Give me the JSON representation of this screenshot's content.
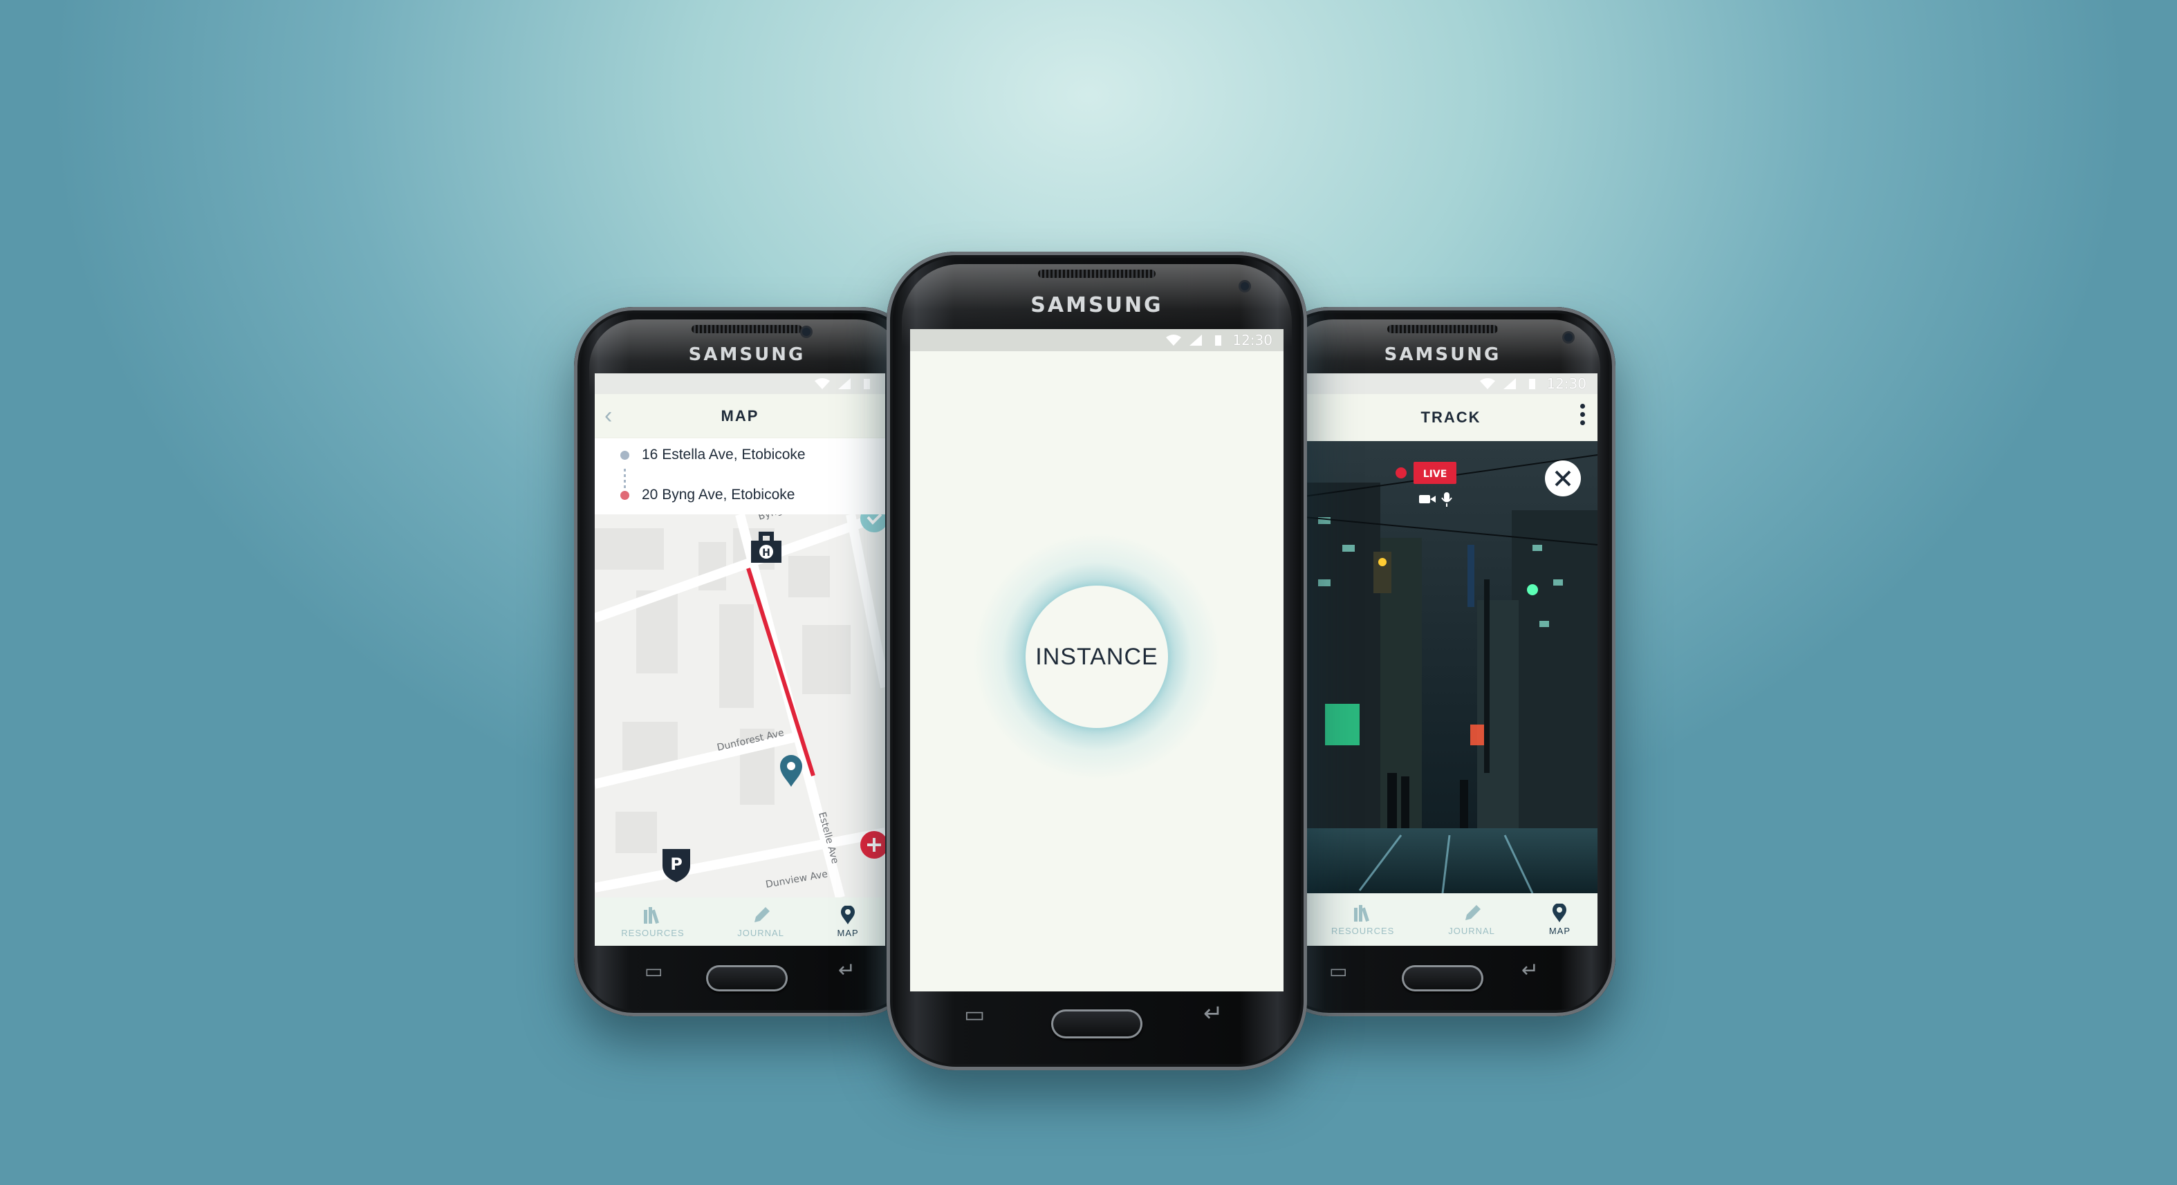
{
  "brand": "SAMSUNG",
  "status_time": "12:30",
  "map_screen": {
    "title": "MAP",
    "origin": "16 Estella Ave, Etobicoke",
    "destination": "20 Byng Ave, Etobicoke",
    "streets": [
      "Byng Ave",
      "Dunforest Ave",
      "Dunview Ave",
      "Estelle Ave"
    ],
    "parking_label": "P",
    "route_color": "#e0243a",
    "tabs": [
      {
        "label": "RESOURCES",
        "icon": "books-icon",
        "active": false
      },
      {
        "label": "JOURNAL",
        "icon": "pencil-icon",
        "active": false
      },
      {
        "label": "MAP",
        "icon": "map-pin-icon",
        "active": true
      }
    ]
  },
  "center_screen": {
    "button_label": "INSTANCE",
    "glow_color": "#9fd2d8"
  },
  "track_screen": {
    "title": "TRACK",
    "live_label": "LIVE",
    "live_color": "#e0243a",
    "tabs": [
      {
        "label": "RESOURCES",
        "icon": "books-icon",
        "active": false
      },
      {
        "label": "JOURNAL",
        "icon": "pencil-icon",
        "active": false
      },
      {
        "label": "MAP",
        "icon": "map-pin-icon",
        "active": true
      }
    ]
  }
}
